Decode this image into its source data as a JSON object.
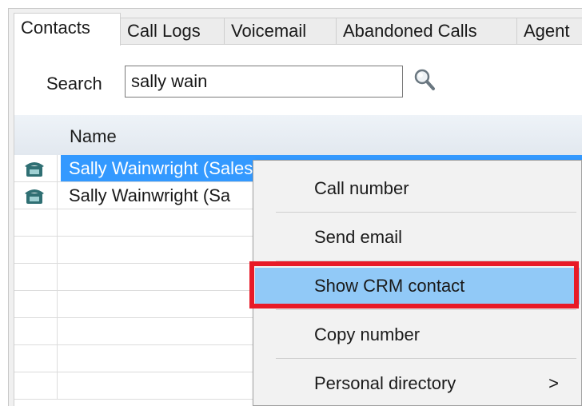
{
  "tabs": [
    {
      "label": "Contacts",
      "active": true
    },
    {
      "label": "Call Logs",
      "active": false
    },
    {
      "label": "Voicemail",
      "active": false
    },
    {
      "label": "Abandoned Calls",
      "active": false
    },
    {
      "label": "Agent",
      "active": false
    }
  ],
  "search": {
    "label": "Search",
    "value": "sally wain"
  },
  "grid": {
    "column_name": "Name",
    "rows": [
      {
        "name": "Sally Wainwright (Salesforce Contact - Mobile)",
        "selected": true,
        "icon": "phone-icon"
      },
      {
        "name": "Sally Wainwright (Sa",
        "selected": false,
        "icon": "phone-icon"
      }
    ]
  },
  "context_menu": {
    "items": [
      {
        "label": "Call number"
      },
      {
        "label": "Send email"
      },
      {
        "label": "Show CRM contact",
        "highlighted": true
      },
      {
        "label": "Copy number"
      },
      {
        "label": "Personal directory",
        "submenu_arrow": ">"
      }
    ]
  },
  "colors": {
    "selection": "#3399ff",
    "menu_highlight": "#91c9f7",
    "annotation_box": "#e81a27",
    "phone_icon": "#2f6f73"
  }
}
